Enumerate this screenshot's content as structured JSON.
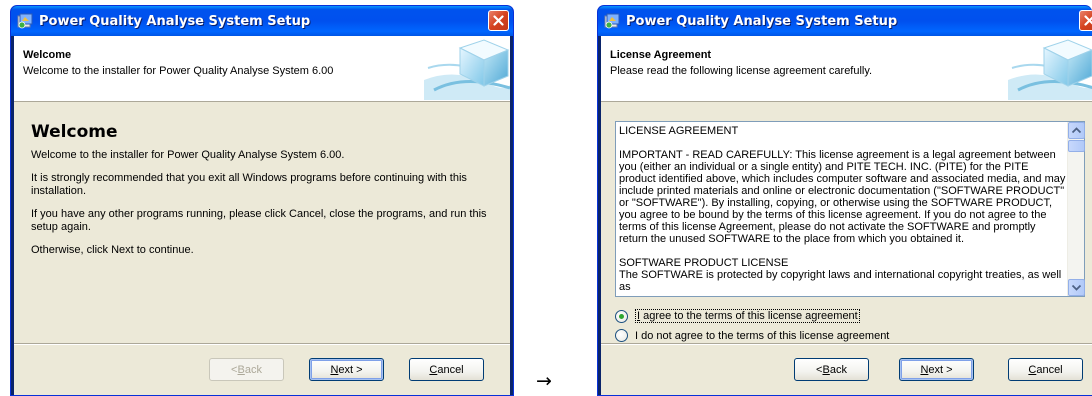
{
  "dialogs": [
    {
      "title": "Power Quality Analyse System Setup",
      "header_title": "Welcome",
      "header_subtitle": "Welcome to the installer for Power Quality Analyse System 6.00",
      "body_title": "Welcome",
      "paragraphs": [
        "Welcome to the installer for Power Quality Analyse System 6.00.",
        "It is strongly recommended that you exit all Windows programs before continuing with this installation.",
        "If you have any other programs running, please click Cancel, close the programs, and run this setup again.",
        "Otherwise, click Next to continue."
      ],
      "buttons": {
        "back_u": "B",
        "back_rest": "ack",
        "back_prefix": "< ",
        "next_u": "N",
        "next_rest": "ext >",
        "cancel_u": "C",
        "cancel_rest": "ancel"
      }
    },
    {
      "title": "Power Quality Analyse System Setup",
      "header_title": "License Agreement",
      "header_subtitle": "Please read the following license agreement carefully.",
      "license_lines": [
        "LICENSE AGREEMENT",
        "IMPORTANT - READ CAREFULLY: This license agreement is a legal agreement between you (either an individual or a single entity) and PITE TECH. INC. (PITE) for the PITE product identified above, which includes computer software and associated media, and may include printed materials and online or electronic documentation (\"SOFTWARE PRODUCT\" or \"SOFTWARE\"). By installing, copying, or otherwise using the SOFTWARE PRODUCT, you agree to be bound by the terms of this license agreement. If you do not agree to the terms of this license Agreement, please do not activate the SOFTWARE and promptly return the unused SOFTWARE to the place from which you obtained it.",
        "SOFTWARE PRODUCT LICENSE",
        "The SOFTWARE is protected by copyright laws and international copyright treaties, as well as"
      ],
      "radio_options": [
        {
          "label_u": "I",
          "label_rest": " agree to the terms of this license agreement",
          "checked": true
        },
        {
          "label": "I do not agree to the terms of this license agreement",
          "checked": false
        }
      ],
      "buttons": {
        "back_u": "B",
        "back_rest": "ack",
        "back_prefix": "< ",
        "next_u": "N",
        "next_rest": "ext >",
        "cancel_u": "C",
        "cancel_rest": "ancel"
      }
    }
  ],
  "arrow": "→",
  "colors": {
    "titlebar": "#0053ee",
    "client": "#ece9d8",
    "close": "#d5421f",
    "radio_check": "#2fa62f"
  },
  "icons": [
    "setup-app-icon",
    "close-icon",
    "header-cube-icon",
    "scroll-up-icon",
    "scroll-down-icon"
  ]
}
